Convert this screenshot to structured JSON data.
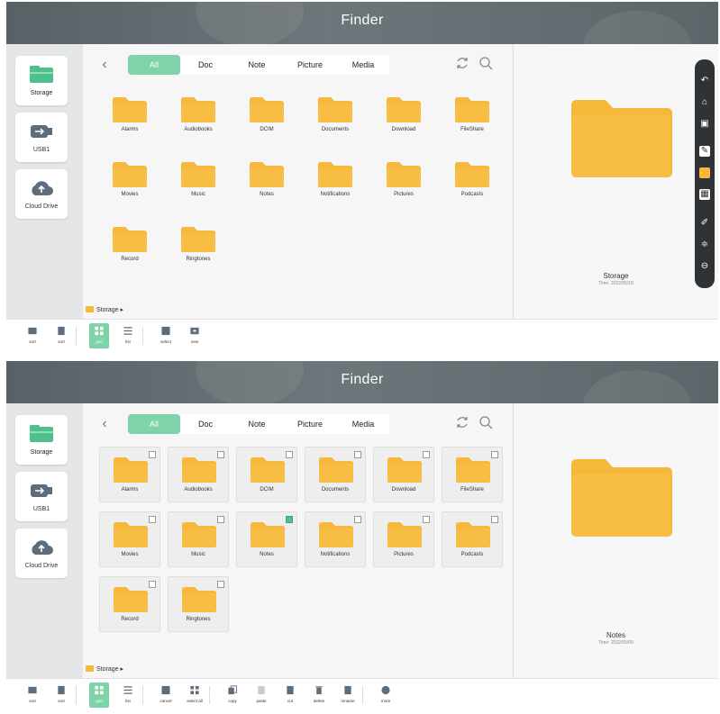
{
  "top": {
    "header": {
      "title": "Finder"
    },
    "sidebar": [
      {
        "label": "Storage",
        "icon": "storage-icon"
      },
      {
        "label": "USB1",
        "icon": "usb-icon"
      },
      {
        "label": "Cloud Drive",
        "icon": "cloud-upload-icon"
      }
    ],
    "filters": [
      "All",
      "Doc",
      "Note",
      "Picture",
      "Media"
    ],
    "active_filter": "All",
    "folders": [
      "Alarms",
      "Audiobooks",
      "DCIM",
      "Documents",
      "Download",
      "FileShare",
      "Movies",
      "Music",
      "Notes",
      "Notifications",
      "Pictures",
      "Podcasts",
      "Record",
      "Ringtones"
    ],
    "breadcrumb": "Storage  ▸",
    "preview": {
      "name": "Storage",
      "time": "Time: 2022/05/18"
    },
    "bottom_buttons": [
      {
        "label": "sort",
        "icon": "sort-folder-icon"
      },
      {
        "label": "sort",
        "icon": "sort-file-icon"
      },
      {
        "label": "grid",
        "icon": "grid-view-icon",
        "active": true
      },
      {
        "label": "list",
        "icon": "list-view-icon"
      },
      {
        "label": "select",
        "icon": "select-icon"
      },
      {
        "label": "new",
        "icon": "new-folder-icon"
      }
    ]
  },
  "bottom": {
    "header": {
      "title": "Finder"
    },
    "sidebar": [
      {
        "label": "Storage",
        "icon": "storage-icon"
      },
      {
        "label": "USB1",
        "icon": "usb-icon"
      },
      {
        "label": "Cloud Drive",
        "icon": "cloud-upload-icon"
      }
    ],
    "filters": [
      "All",
      "Doc",
      "Note",
      "Picture",
      "Media"
    ],
    "active_filter": "All",
    "folders": [
      "Alarms",
      "Audiobooks",
      "DCIM",
      "Documents",
      "Download",
      "FileShare",
      "Movies",
      "Music",
      "Notes",
      "Notifications",
      "Pictures",
      "Podcasts",
      "Record",
      "Ringtones"
    ],
    "checked_folder": "Notes",
    "breadcrumb": "Storage  ▸",
    "preview": {
      "name": "Notes",
      "time": "Time: 2022/05/09"
    },
    "bottom_buttons": [
      {
        "label": "sort",
        "icon": "sort-folder-icon"
      },
      {
        "label": "sort",
        "icon": "sort-file-icon"
      },
      {
        "label": "grid",
        "icon": "grid-view-icon",
        "active": true
      },
      {
        "label": "list",
        "icon": "list-view-icon"
      },
      {
        "label": "cancel",
        "icon": "cancel-select-icon"
      },
      {
        "label": "select all",
        "icon": "select-all-icon"
      },
      {
        "label": "copy",
        "icon": "copy-icon"
      },
      {
        "label": "paste",
        "icon": "paste-icon"
      },
      {
        "label": "cut",
        "icon": "cut-icon"
      },
      {
        "label": "delete",
        "icon": "delete-icon"
      },
      {
        "label": "rename",
        "icon": "rename-icon"
      },
      {
        "label": "more",
        "icon": "more-icon"
      }
    ]
  },
  "colors": {
    "accent": "#7fd3a8",
    "folder": "#f5b83a",
    "header": "#626b70",
    "checked": "#4ec08b"
  }
}
